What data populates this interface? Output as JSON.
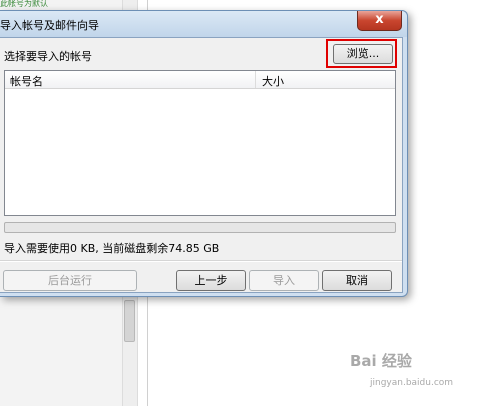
{
  "background_app": {
    "top_text": "此帐号为默认"
  },
  "dialog": {
    "title": "导入帐号及邮件向导",
    "close_glyph": "x",
    "prompt_label": "选择要导入的帐号",
    "browse_label": "浏览...",
    "list": {
      "columns": [
        "帐号名",
        "大小"
      ],
      "rows": []
    },
    "progress": 0,
    "status_text": "导入需要使用0 KB, 当前磁盘剩余74.85 GB",
    "buttons": {
      "background_run": "后台运行",
      "previous": "上一步",
      "import": "导入",
      "cancel": "取消"
    }
  },
  "watermark": {
    "brand": "Bai 经验",
    "sub": "jingyan.baidu.com"
  },
  "colors": {
    "highlight": "#e00000",
    "close_button": "#c9462f"
  }
}
